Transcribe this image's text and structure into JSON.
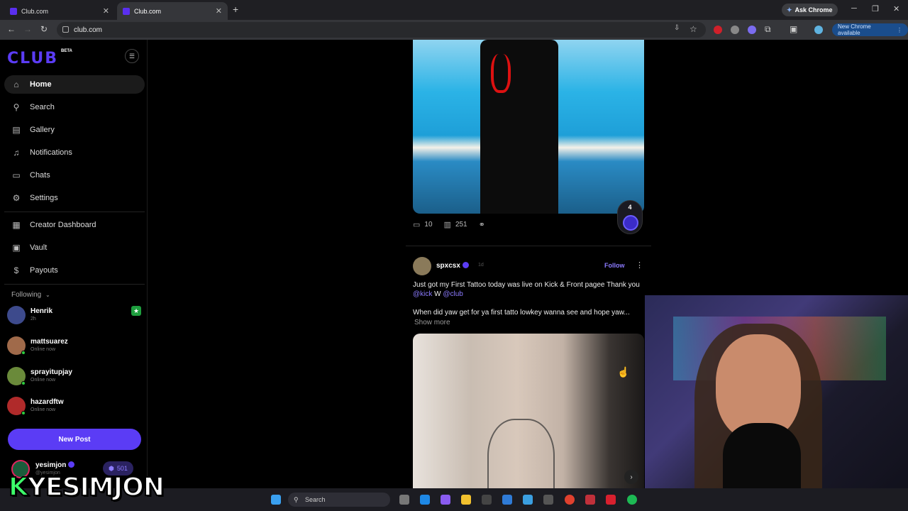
{
  "browser": {
    "tabs": [
      {
        "title": "Club.com"
      },
      {
        "title": "Club.com"
      }
    ],
    "ask_chrome": "Ask Chrome",
    "url": "club.com",
    "new_chrome": "New Chrome available"
  },
  "sidebar": {
    "logo": "CLUB",
    "beta": "BETA",
    "nav": [
      {
        "label": "Home",
        "icon": "home-icon"
      },
      {
        "label": "Search",
        "icon": "search-icon"
      },
      {
        "label": "Gallery",
        "icon": "gallery-icon"
      },
      {
        "label": "Notifications",
        "icon": "bell-icon"
      },
      {
        "label": "Chats",
        "icon": "chat-icon"
      },
      {
        "label": "Settings",
        "icon": "gear-icon"
      }
    ],
    "nav2": [
      {
        "label": "Creator Dashboard",
        "icon": "dashboard-icon"
      },
      {
        "label": "Vault",
        "icon": "vault-icon"
      },
      {
        "label": "Payouts",
        "icon": "dollar-icon"
      }
    ],
    "following_label": "Following",
    "following": [
      {
        "name": "Henrik",
        "status": "2h"
      },
      {
        "name": "mattsuarez",
        "status": "Online now"
      },
      {
        "name": "sprayitupjay",
        "status": "Online now"
      },
      {
        "name": "hazardftw",
        "status": "Online now"
      }
    ],
    "new_post": "New Post",
    "me": {
      "name": "yesimjon",
      "handle": "@yesimjon",
      "coins": "501"
    }
  },
  "feed": {
    "post1": {
      "comments": "10",
      "views": "251",
      "rank": "4"
    },
    "post2": {
      "user": "spxcsx",
      "time": "1d",
      "follow": "Follow",
      "text_prefix": "Just got my First Tattoo today was live on Kick & Front pagee Thank you ",
      "mention1": "@kick",
      "text_mid": " W ",
      "mention2": "@club",
      "text2": "When did yaw get for ya first tatto lowkey wanna see and hope yaw...",
      "show_more": "Show more"
    }
  },
  "taskbar": {
    "search": "Search"
  },
  "overlay": {
    "k": "K",
    "name": "YESIMJON"
  }
}
